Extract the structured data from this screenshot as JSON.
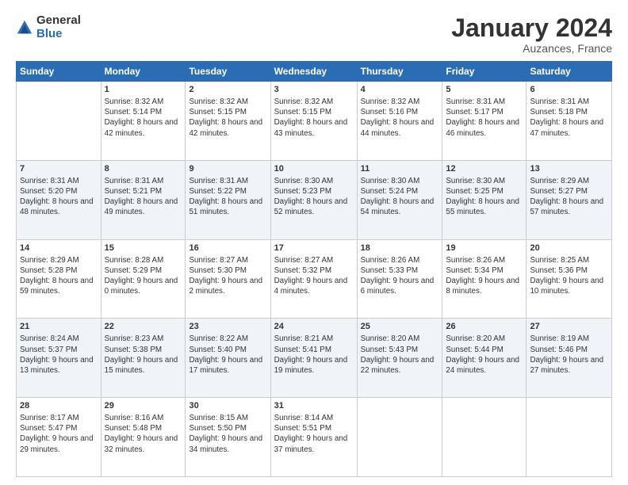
{
  "logo": {
    "general": "General",
    "blue": "Blue"
  },
  "header": {
    "month": "January 2024",
    "location": "Auzances, France"
  },
  "weekdays": [
    "Sunday",
    "Monday",
    "Tuesday",
    "Wednesday",
    "Thursday",
    "Friday",
    "Saturday"
  ],
  "weeks": [
    [
      {
        "day": "",
        "sunrise": "",
        "sunset": "",
        "daylight": ""
      },
      {
        "day": "1",
        "sunrise": "Sunrise: 8:32 AM",
        "sunset": "Sunset: 5:14 PM",
        "daylight": "Daylight: 8 hours and 42 minutes."
      },
      {
        "day": "2",
        "sunrise": "Sunrise: 8:32 AM",
        "sunset": "Sunset: 5:15 PM",
        "daylight": "Daylight: 8 hours and 42 minutes."
      },
      {
        "day": "3",
        "sunrise": "Sunrise: 8:32 AM",
        "sunset": "Sunset: 5:15 PM",
        "daylight": "Daylight: 8 hours and 43 minutes."
      },
      {
        "day": "4",
        "sunrise": "Sunrise: 8:32 AM",
        "sunset": "Sunset: 5:16 PM",
        "daylight": "Daylight: 8 hours and 44 minutes."
      },
      {
        "day": "5",
        "sunrise": "Sunrise: 8:31 AM",
        "sunset": "Sunset: 5:17 PM",
        "daylight": "Daylight: 8 hours and 46 minutes."
      },
      {
        "day": "6",
        "sunrise": "Sunrise: 8:31 AM",
        "sunset": "Sunset: 5:18 PM",
        "daylight": "Daylight: 8 hours and 47 minutes."
      }
    ],
    [
      {
        "day": "7",
        "sunrise": "Sunrise: 8:31 AM",
        "sunset": "Sunset: 5:20 PM",
        "daylight": "Daylight: 8 hours and 48 minutes."
      },
      {
        "day": "8",
        "sunrise": "Sunrise: 8:31 AM",
        "sunset": "Sunset: 5:21 PM",
        "daylight": "Daylight: 8 hours and 49 minutes."
      },
      {
        "day": "9",
        "sunrise": "Sunrise: 8:31 AM",
        "sunset": "Sunset: 5:22 PM",
        "daylight": "Daylight: 8 hours and 51 minutes."
      },
      {
        "day": "10",
        "sunrise": "Sunrise: 8:30 AM",
        "sunset": "Sunset: 5:23 PM",
        "daylight": "Daylight: 8 hours and 52 minutes."
      },
      {
        "day": "11",
        "sunrise": "Sunrise: 8:30 AM",
        "sunset": "Sunset: 5:24 PM",
        "daylight": "Daylight: 8 hours and 54 minutes."
      },
      {
        "day": "12",
        "sunrise": "Sunrise: 8:30 AM",
        "sunset": "Sunset: 5:25 PM",
        "daylight": "Daylight: 8 hours and 55 minutes."
      },
      {
        "day": "13",
        "sunrise": "Sunrise: 8:29 AM",
        "sunset": "Sunset: 5:27 PM",
        "daylight": "Daylight: 8 hours and 57 minutes."
      }
    ],
    [
      {
        "day": "14",
        "sunrise": "Sunrise: 8:29 AM",
        "sunset": "Sunset: 5:28 PM",
        "daylight": "Daylight: 8 hours and 59 minutes."
      },
      {
        "day": "15",
        "sunrise": "Sunrise: 8:28 AM",
        "sunset": "Sunset: 5:29 PM",
        "daylight": "Daylight: 9 hours and 0 minutes."
      },
      {
        "day": "16",
        "sunrise": "Sunrise: 8:27 AM",
        "sunset": "Sunset: 5:30 PM",
        "daylight": "Daylight: 9 hours and 2 minutes."
      },
      {
        "day": "17",
        "sunrise": "Sunrise: 8:27 AM",
        "sunset": "Sunset: 5:32 PM",
        "daylight": "Daylight: 9 hours and 4 minutes."
      },
      {
        "day": "18",
        "sunrise": "Sunrise: 8:26 AM",
        "sunset": "Sunset: 5:33 PM",
        "daylight": "Daylight: 9 hours and 6 minutes."
      },
      {
        "day": "19",
        "sunrise": "Sunrise: 8:26 AM",
        "sunset": "Sunset: 5:34 PM",
        "daylight": "Daylight: 9 hours and 8 minutes."
      },
      {
        "day": "20",
        "sunrise": "Sunrise: 8:25 AM",
        "sunset": "Sunset: 5:36 PM",
        "daylight": "Daylight: 9 hours and 10 minutes."
      }
    ],
    [
      {
        "day": "21",
        "sunrise": "Sunrise: 8:24 AM",
        "sunset": "Sunset: 5:37 PM",
        "daylight": "Daylight: 9 hours and 13 minutes."
      },
      {
        "day": "22",
        "sunrise": "Sunrise: 8:23 AM",
        "sunset": "Sunset: 5:38 PM",
        "daylight": "Daylight: 9 hours and 15 minutes."
      },
      {
        "day": "23",
        "sunrise": "Sunrise: 8:22 AM",
        "sunset": "Sunset: 5:40 PM",
        "daylight": "Daylight: 9 hours and 17 minutes."
      },
      {
        "day": "24",
        "sunrise": "Sunrise: 8:21 AM",
        "sunset": "Sunset: 5:41 PM",
        "daylight": "Daylight: 9 hours and 19 minutes."
      },
      {
        "day": "25",
        "sunrise": "Sunrise: 8:20 AM",
        "sunset": "Sunset: 5:43 PM",
        "daylight": "Daylight: 9 hours and 22 minutes."
      },
      {
        "day": "26",
        "sunrise": "Sunrise: 8:20 AM",
        "sunset": "Sunset: 5:44 PM",
        "daylight": "Daylight: 9 hours and 24 minutes."
      },
      {
        "day": "27",
        "sunrise": "Sunrise: 8:19 AM",
        "sunset": "Sunset: 5:46 PM",
        "daylight": "Daylight: 9 hours and 27 minutes."
      }
    ],
    [
      {
        "day": "28",
        "sunrise": "Sunrise: 8:17 AM",
        "sunset": "Sunset: 5:47 PM",
        "daylight": "Daylight: 9 hours and 29 minutes."
      },
      {
        "day": "29",
        "sunrise": "Sunrise: 8:16 AM",
        "sunset": "Sunset: 5:48 PM",
        "daylight": "Daylight: 9 hours and 32 minutes."
      },
      {
        "day": "30",
        "sunrise": "Sunrise: 8:15 AM",
        "sunset": "Sunset: 5:50 PM",
        "daylight": "Daylight: 9 hours and 34 minutes."
      },
      {
        "day": "31",
        "sunrise": "Sunrise: 8:14 AM",
        "sunset": "Sunset: 5:51 PM",
        "daylight": "Daylight: 9 hours and 37 minutes."
      },
      {
        "day": "",
        "sunrise": "",
        "sunset": "",
        "daylight": ""
      },
      {
        "day": "",
        "sunrise": "",
        "sunset": "",
        "daylight": ""
      },
      {
        "day": "",
        "sunrise": "",
        "sunset": "",
        "daylight": ""
      }
    ]
  ]
}
